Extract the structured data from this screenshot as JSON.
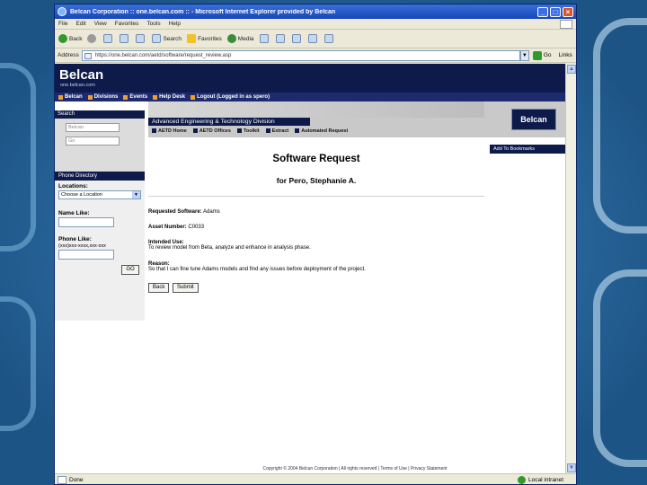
{
  "window": {
    "title": "Belcan Corporation :: one.belcan.com :: - Microsoft Internet Explorer provided by Belcan",
    "menu": [
      "File",
      "Edit",
      "View",
      "Favorites",
      "Tools",
      "Help"
    ]
  },
  "toolbar": {
    "back": "Back",
    "search": "Search",
    "favorites": "Favorites",
    "media": "Media"
  },
  "address": {
    "label": "Address",
    "value": "https://one.belcan.com/aetd/software/request_review.asp",
    "go": "Go",
    "links": "Links"
  },
  "site": {
    "logo": "Belcan",
    "logo_sub": "one.belcan.com",
    "nav": [
      "Belcan",
      "Divisions",
      "Events",
      "Help Desk",
      "Logout (Logged in as spero)"
    ]
  },
  "search_panel": {
    "header": "Search",
    "field1": "Belcan",
    "field2": "Go"
  },
  "banner": {
    "division": "Advanced Engineering & Technology Division",
    "tabs": [
      "AETD Home",
      "AETD Offices",
      "Toolkit",
      "Extract",
      "Automated Request"
    ],
    "brand": "Belcan",
    "bookmark": "Add To Bookmarks"
  },
  "directory": {
    "header": "Phone Directory",
    "locations_label": "Locations:",
    "locations_value": "Choose a Location",
    "name_label": "Name Like:",
    "phone_label": "Phone Like:",
    "phone_hint": "(xxx)xxx-xxxx,xxx-xxx",
    "go": "GO"
  },
  "form": {
    "title": "Software Request",
    "subtitle": "for Pero, Stephanie A.",
    "requested_label": "Requested Software:",
    "requested_value": "Adams",
    "asset_label": "Asset Number:",
    "asset_value": "C0033",
    "use_label": "Intended Use:",
    "use_value": "To review model from Beta, analyze and enhance in analysis phase.",
    "reason_label": "Reason:",
    "reason_value": "So that I can fine tune Adams models and find any issues before deployment of the project.",
    "back_button": "Back",
    "submit_button": "Submit"
  },
  "footer": {
    "text": "Copyright © 2004 Belcan Corporation | All rights reserved | Terms of Use | Privacy Statement"
  },
  "status": {
    "left": "Done",
    "zone": "Local intranet"
  }
}
